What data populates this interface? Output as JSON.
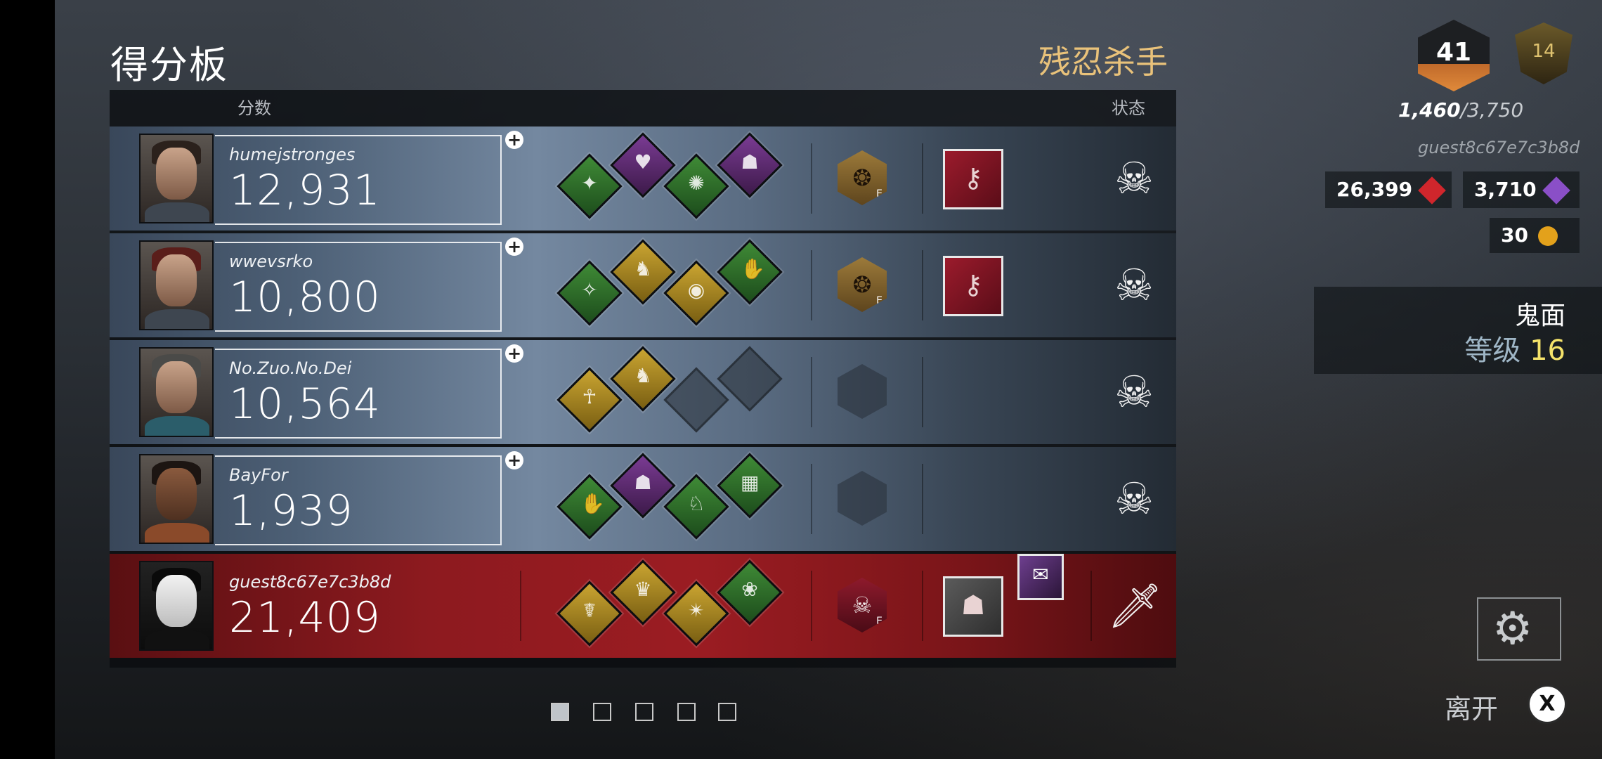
{
  "title": "得分板",
  "result_title": "残忍杀手",
  "headers": {
    "score": "分数",
    "status": "状态"
  },
  "players": [
    {
      "name": "humejstronges",
      "score": "12,931",
      "perks": [
        "green",
        "purple",
        "green",
        "purple"
      ],
      "offering": "gold",
      "item": "red",
      "status": "skull-icon"
    },
    {
      "name": "wwevsrko",
      "score": "10,800",
      "perks": [
        "green",
        "yellow",
        "yellow",
        "green"
      ],
      "offering": "gold",
      "item": "red",
      "status": "skull-icon"
    },
    {
      "name": "No.Zuo.No.Dei",
      "score": "10,564",
      "perks": [
        "yellow",
        "yellow",
        "empty",
        "empty"
      ],
      "offering": "empty",
      "item": "none",
      "status": "skull-icon"
    },
    {
      "name": "BayFor",
      "score": "1,939",
      "perks": [
        "green",
        "purple",
        "green",
        "green"
      ],
      "offering": "empty",
      "item": "none",
      "status": "skull-icon"
    }
  ],
  "killer": {
    "name": "guest8c67e7c3b8d",
    "score": "21,409",
    "perks": [
      "yellow",
      "yellow",
      "yellow",
      "green"
    ],
    "offering": "red",
    "status": "knife-icon"
  },
  "pager": {
    "total": 5,
    "active": 0
  },
  "profile": {
    "rank": "41",
    "prestige": "14",
    "xp_current": "1,460",
    "xp_total": "/3,750",
    "username": "guest8c67e7c3b8d",
    "bloodpoints": "26,399",
    "iridescent_shards": "3,710",
    "auric_cells": "30"
  },
  "killer_info": {
    "name": "鬼面",
    "level_label": "等级",
    "level": "16"
  },
  "leave_label": "离开",
  "leave_key": "X",
  "colors": {
    "killer_row": "#8d1a1f",
    "gold_text": "#e9c27a",
    "level_yellow": "#f5e36a"
  }
}
